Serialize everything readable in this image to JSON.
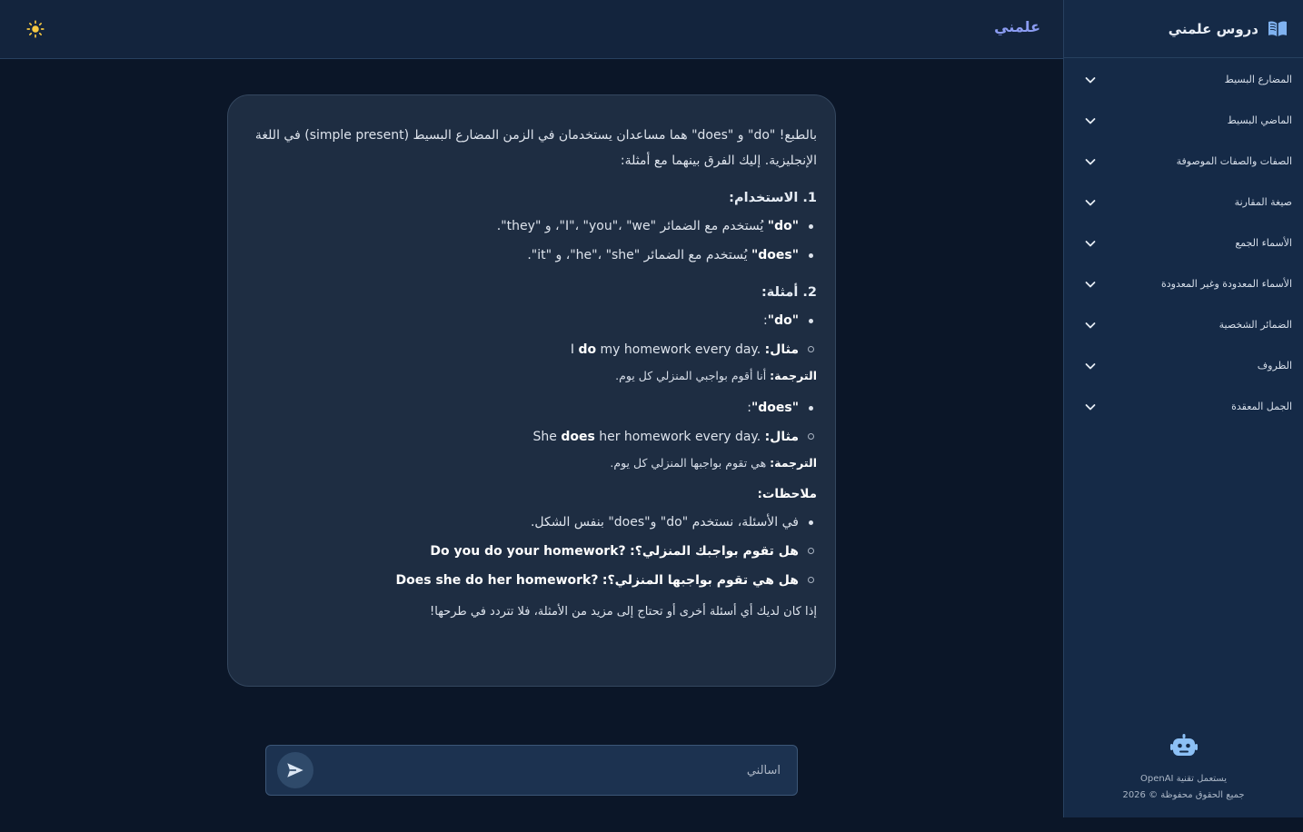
{
  "brand": {
    "sidebar_title": "دروس علمني",
    "topbar_title": "علمني"
  },
  "colors": {
    "background": "#0b1628",
    "sidebar": "#152a47",
    "accent": "#8b9cf2",
    "card": "#1e2d42"
  },
  "sidebar": {
    "items": [
      {
        "label": "المضارع البسيط"
      },
      {
        "label": "الماضي البسيط"
      },
      {
        "label": "الصفات والصفات الموصوفة"
      },
      {
        "label": "صيغة المقارنة"
      },
      {
        "label": "الأسماء الجمع"
      },
      {
        "label": "الأسماء المعدودة وغير المعدودة"
      },
      {
        "label": "الضمائر الشخصية"
      },
      {
        "label": "الظروف"
      },
      {
        "label": "الجمل المعقدة"
      }
    ],
    "footer": {
      "powered_by": "يستعمل تقنية OpenAI",
      "copyright": "جميع الحقوق محفوظة © 2026"
    }
  },
  "message": {
    "intro": "بالطبع! \"do\" و \"does\" هما مساعدان يستخدمان في الزمن المضارع البسيط (simple present) في اللغة الإنجليزية. إليك الفرق بينهما مع أمثلة:",
    "section1_title": "1. الاستخدام:",
    "usage": [
      {
        "term": "\"do\"",
        "text": " يُستخدم مع الضمائر \"I\"، \"you\"، \"we\"، و \"they\"."
      },
      {
        "term": "\"does\"",
        "text": " يُستخدم مع الضمائر \"he\"، \"she\"، و \"it\"."
      }
    ],
    "section2_title": "2. أمثلة:",
    "examples": [
      {
        "term": "\"do\"",
        "colon": ":",
        "example_label": "مثال:",
        "example_pre": "I ",
        "example_bold": "do",
        "example_post": " my homework every day.",
        "translation_label": "الترجمة:",
        "translation": " أنا أقوم بواجبي المنزلي كل يوم."
      },
      {
        "term": "\"does\"",
        "colon": ":",
        "example_label": "مثال:",
        "example_pre": "She ",
        "example_bold": "does",
        "example_post": " her homework every day.",
        "translation_label": "الترجمة:",
        "translation": " هي تقوم بواجبها المنزلي كل يوم."
      }
    ],
    "notes_title": "ملاحظات:",
    "notes": [
      {
        "text": "في الأسئلة، نستخدم \"do\" و\"does\" بنفس الشكل."
      }
    ],
    "questions": [
      {
        "ar": "هل تقوم بواجبك المنزلي؟:",
        "en": "Do you do your homework?"
      },
      {
        "ar": "هل هي تقوم بواجبها المنزلي؟:",
        "en": "Does she do her homework?"
      }
    ],
    "closing": "إذا كان لديك أي أسئلة أخرى أو تحتاج إلى مزيد من الأمثلة، فلا تتردد في طرحها!"
  },
  "input": {
    "placeholder": "اسألني",
    "value": ""
  },
  "icons": {
    "theme": "sun-icon",
    "send": "send-icon",
    "brand": "open-book-icon",
    "bot": "robot-icon",
    "chevron": "chevron-down-icon"
  }
}
